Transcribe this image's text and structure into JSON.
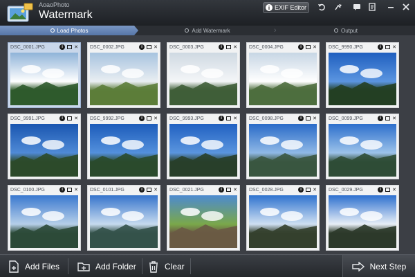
{
  "app": {
    "subtitle": "AoaoPhoto",
    "title": "Watermark"
  },
  "toolbar": {
    "exif_label": "EXIF Editor"
  },
  "steps": [
    {
      "label": "Load Photos",
      "active": true
    },
    {
      "label": "Add Watermark",
      "active": false
    },
    {
      "label": "Output",
      "active": false
    }
  ],
  "photos": [
    "DSC_0001.JPG",
    "DSC_0002.JPG",
    "DSC_0003.JPG",
    "DSC_0004.JPG",
    "DSC_9990.JPG",
    "DSC_9991.JPG",
    "DSC_9992.JPG",
    "DSC_9993.JPG",
    "DSC_0098.JPG",
    "DSC_0099.JPG",
    "DSC_0100.JPG",
    "DSC_0101.JPG",
    "DSC_0021.JPG",
    "DSC_0028.JPG",
    "DSC_0029.JPG"
  ],
  "footer": {
    "add_files": "Add Files",
    "add_folder": "Add Folder",
    "clear": "Clear",
    "next": "Next Step"
  },
  "colors": {
    "accent": "#5676a8",
    "background": "#3a3d43"
  }
}
